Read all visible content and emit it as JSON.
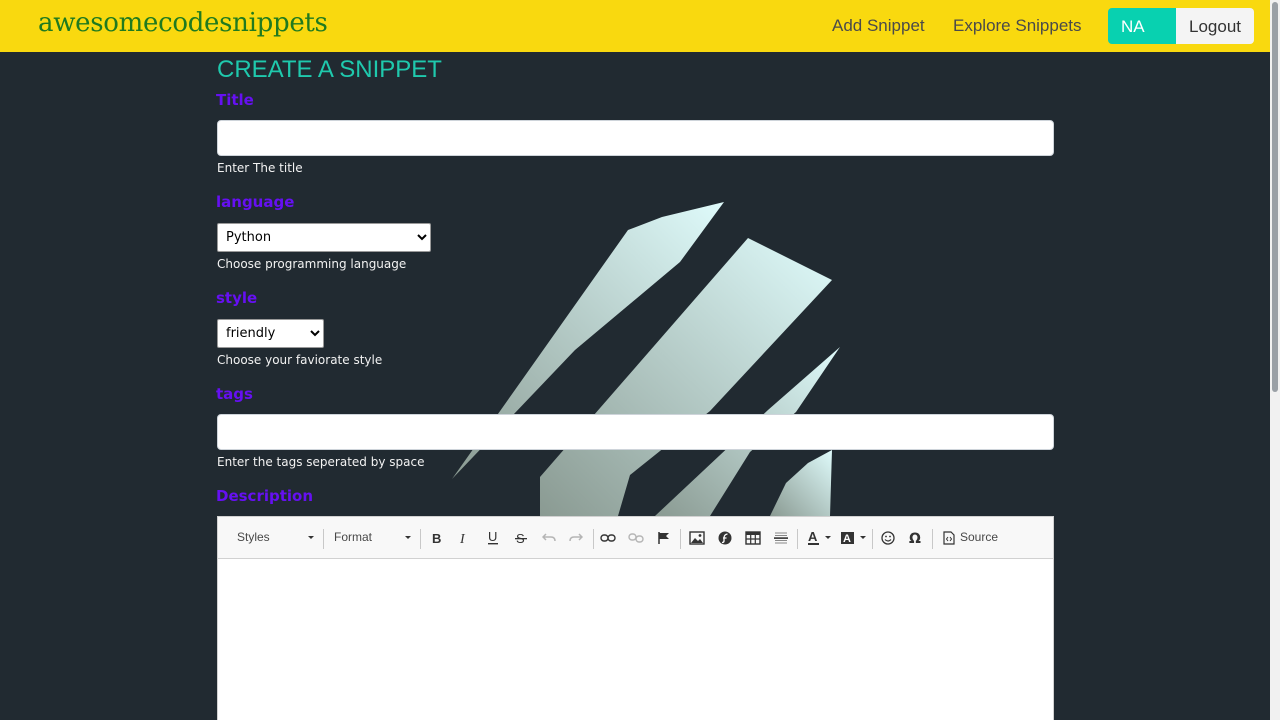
{
  "navbar": {
    "brand": "awesomecodesnippets",
    "links": [
      "Add Snippet",
      "Explore Snippets"
    ],
    "user_initials": "NA",
    "logout_label": "Logout",
    "bg_color": "#f9d90f"
  },
  "form": {
    "heading": "CREATE A SNIPPET",
    "title": {
      "label": "Title",
      "value": "",
      "help": "Enter The title"
    },
    "language": {
      "label": "language",
      "selected": "Python",
      "help": "Choose programming language"
    },
    "style": {
      "label": "style",
      "selected": "friendly",
      "help": "Choose your faviorate style"
    },
    "tags": {
      "label": "tags",
      "value": "",
      "help": "Enter the tags seperated by space"
    },
    "description": {
      "label": "Description"
    }
  },
  "editor": {
    "styles_label": "Styles",
    "format_label": "Format",
    "source_label": "Source",
    "buttons": [
      "bold-icon",
      "italic-icon",
      "underline-icon",
      "strikethrough-icon",
      "undo-icon",
      "redo-icon",
      "link-icon",
      "unlink-icon",
      "anchor-flag-icon",
      "image-icon",
      "flash-icon",
      "table-icon",
      "horizontal-line-icon",
      "text-color-icon",
      "background-color-icon",
      "smiley-icon",
      "special-char-omega-icon",
      "source-icon"
    ]
  },
  "colors": {
    "accent_teal": "#08d1b0",
    "label_purple": "#6610f2",
    "page_bg": "#212a31"
  }
}
